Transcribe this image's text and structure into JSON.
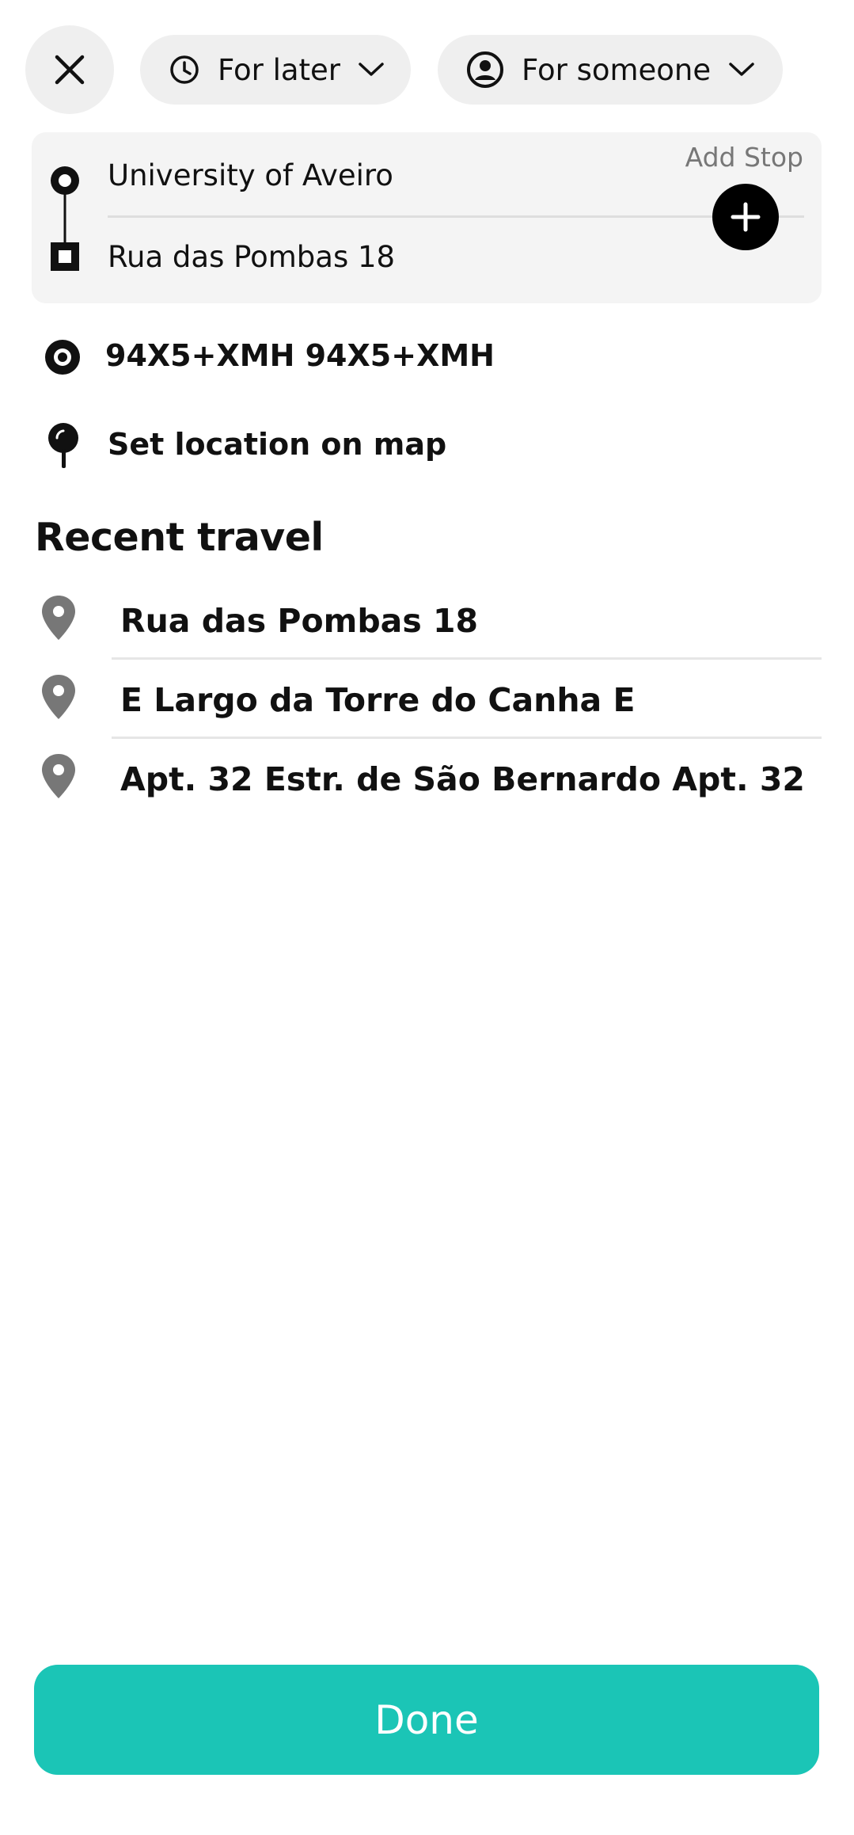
{
  "top_bar": {
    "schedule_label": "For later",
    "rider_label": "For someone"
  },
  "route": {
    "pickup_value": "University of Aveiro",
    "destination_value": "Rua das Pombas 18",
    "add_stop_label": "Add Stop"
  },
  "suggestions": {
    "current_location": "94X5+XMH 94X5+XMH",
    "set_on_map": "Set location on map"
  },
  "recent": {
    "title": "Recent travel",
    "items": [
      {
        "label": "Rua das Pombas 18"
      },
      {
        "label": "E Largo da Torre do Canha E"
      },
      {
        "label": "Apt. 32 Estr. de São Bernardo Apt. 32"
      }
    ]
  },
  "done_label": "Done",
  "colors": {
    "accent": "#1bc5b6",
    "pill_bg": "#efefef",
    "card_bg": "#f4f4f4",
    "pin_gray": "#777777"
  },
  "icons": [
    "close-icon",
    "clock-icon",
    "chevron-down-icon",
    "user-circle-icon",
    "origin-dot-icon",
    "destination-square-icon",
    "plus-icon",
    "location-target-icon",
    "map-pin-icon"
  ]
}
